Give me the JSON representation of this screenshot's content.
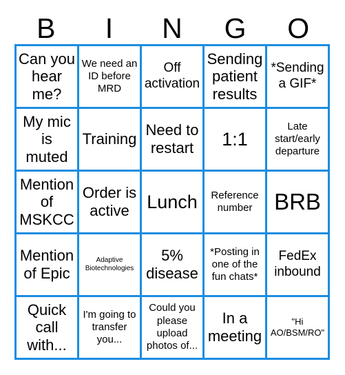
{
  "header": {
    "letters": [
      "B",
      "I",
      "N",
      "G",
      "O"
    ]
  },
  "grid": {
    "columns": 5,
    "rows": 5,
    "border_color": "#1b8de0",
    "background_color": "#ffffff",
    "text_color": "#000000",
    "cells": [
      {
        "text": "Can you hear me?",
        "size": "lg"
      },
      {
        "text": "We need an ID before MRD",
        "size": "sm"
      },
      {
        "text": "Off activation",
        "size": "md"
      },
      {
        "text": "Sending patient results",
        "size": "lg"
      },
      {
        "text": "*Sending a GIF*",
        "size": "md"
      },
      {
        "text": "My mic is muted",
        "size": "lg"
      },
      {
        "text": "Training",
        "size": "lg"
      },
      {
        "text": "Need to restart",
        "size": "lg"
      },
      {
        "text": "1:1",
        "size": "xl"
      },
      {
        "text": "Late start/early departure",
        "size": "sm"
      },
      {
        "text": "Mention of MSKCC",
        "size": "lg"
      },
      {
        "text": "Order is active",
        "size": "lg"
      },
      {
        "text": "Lunch",
        "size": "xl"
      },
      {
        "text": "Reference number",
        "size": "sm"
      },
      {
        "text": "BRB",
        "size": "xxl"
      },
      {
        "text": "Mention of Epic",
        "size": "lg"
      },
      {
        "text": "Adaptive Biotechnologies",
        "size": "xxs"
      },
      {
        "text": "5% disease",
        "size": "lg"
      },
      {
        "text": "*Posting in one of the fun chats*",
        "size": "sm"
      },
      {
        "text": "FedEx inbound",
        "size": "md"
      },
      {
        "text": "Quick call with...",
        "size": "lg"
      },
      {
        "text": "I'm going to transfer you...",
        "size": "sm"
      },
      {
        "text": "Could you please upload photos of...",
        "size": "sm"
      },
      {
        "text": "In a meeting",
        "size": "lg"
      },
      {
        "text": "\"Hi AO/BSM/RO\"",
        "size": "xs"
      }
    ]
  }
}
